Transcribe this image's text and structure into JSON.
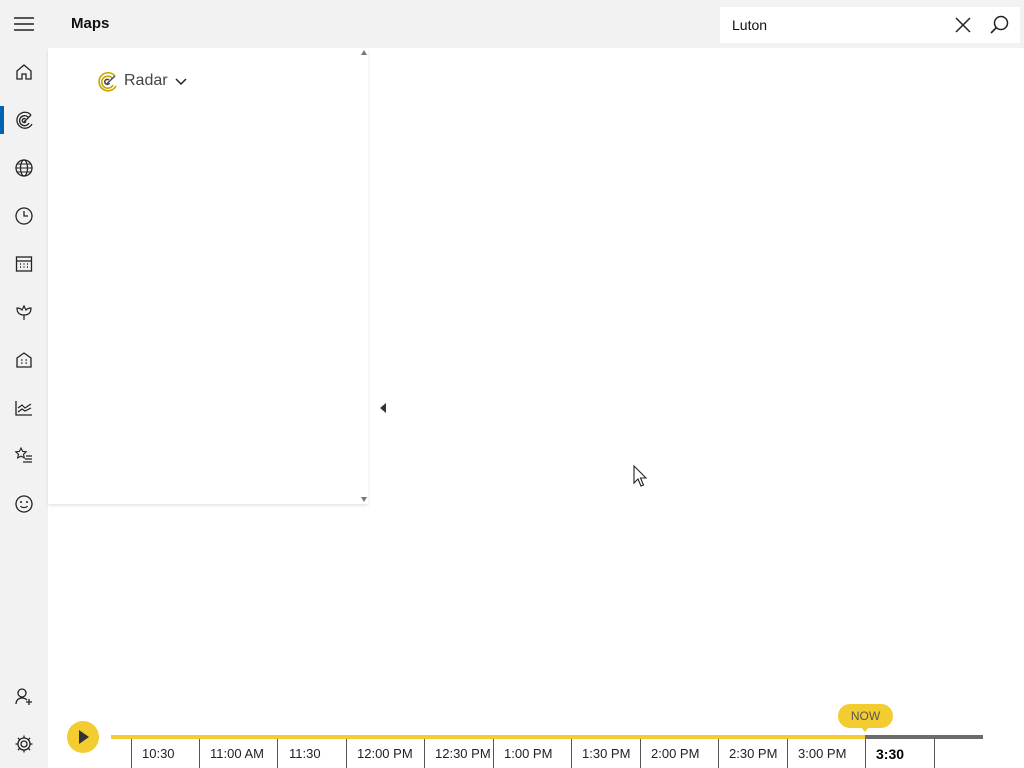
{
  "header": {
    "app_title": "Maps",
    "search": {
      "value": "Luton"
    }
  },
  "nav": {
    "items": [
      {
        "name": "home",
        "icon": "home-icon"
      },
      {
        "name": "maps",
        "icon": "radar-icon",
        "active": true
      },
      {
        "name": "news",
        "icon": "globe-icon"
      },
      {
        "name": "hourly",
        "icon": "clock-icon"
      },
      {
        "name": "monthly",
        "icon": "calendar-icon"
      },
      {
        "name": "life",
        "icon": "flower-icon"
      },
      {
        "name": "places",
        "icon": "building-icon"
      },
      {
        "name": "historical",
        "icon": "chart-icon"
      },
      {
        "name": "favorites",
        "icon": "star-list-icon"
      },
      {
        "name": "feedback",
        "icon": "smiley-icon"
      }
    ],
    "bottom_items": [
      {
        "name": "account",
        "icon": "add-person-icon"
      },
      {
        "name": "settings",
        "icon": "gear-icon"
      }
    ]
  },
  "panel": {
    "layer_label": "Radar"
  },
  "timeline": {
    "now_label": "NOW",
    "ticks": [
      "10:30",
      "11:00 AM",
      "11:30",
      "12:00 PM",
      "12:30 PM",
      "1:00 PM",
      "1:30 PM",
      "2:00 PM",
      "2:30 PM",
      "3:00 PM",
      "3:30"
    ],
    "current_index": 10
  },
  "colors": {
    "accent": "#0063b1",
    "timeline_yellow": "#f3cc2f",
    "chrome": "#f2f2f2"
  }
}
